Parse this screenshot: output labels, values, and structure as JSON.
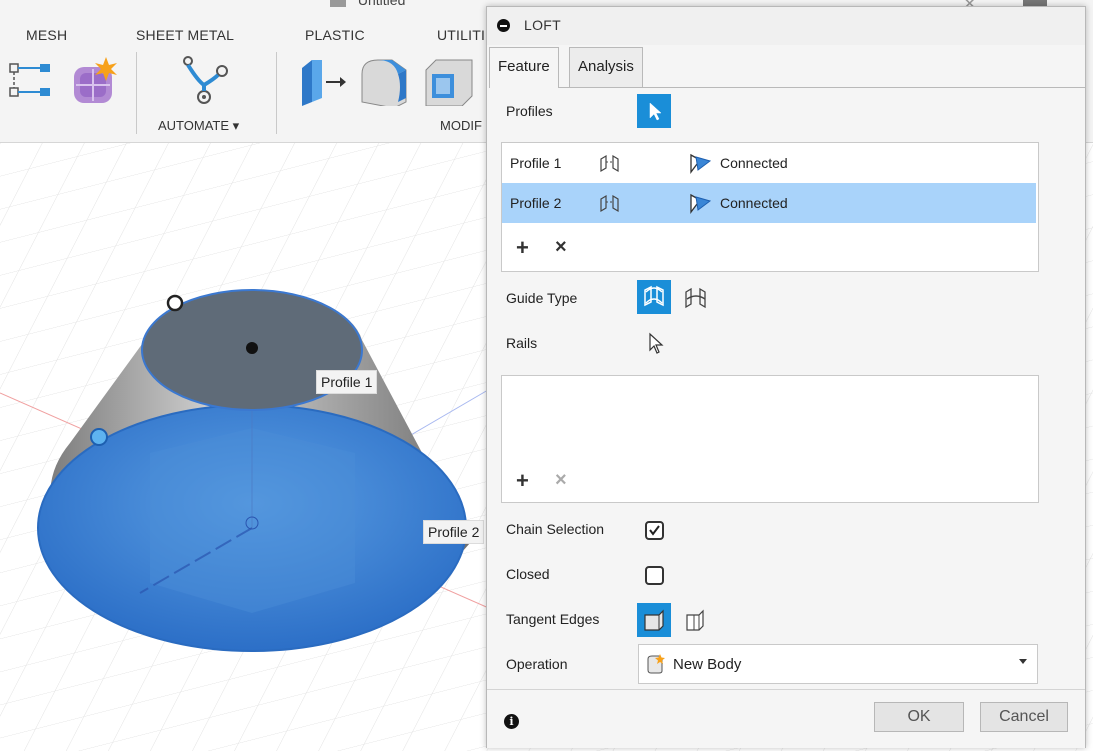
{
  "window": {
    "title": "Untitled"
  },
  "ribbon": {
    "tabs": [
      "MESH",
      "SHEET METAL",
      "PLASTIC",
      "UTILITI"
    ],
    "captions": {
      "automate": "AUTOMATE ▾",
      "modify": "MODIF"
    }
  },
  "canvas": {
    "labels": {
      "profile1": "Profile 1",
      "profile2": "Profile 2"
    }
  },
  "dialog": {
    "title": "LOFT",
    "tabs": [
      {
        "label": "Feature",
        "active": true
      },
      {
        "label": "Analysis",
        "active": false
      }
    ],
    "profiles_label": "Profiles",
    "profiles": [
      {
        "name": "Profile 1",
        "status": "Connected",
        "selected": false
      },
      {
        "name": "Profile 2",
        "status": "Connected",
        "selected": true
      }
    ],
    "guide_type_label": "Guide Type",
    "rails_label": "Rails",
    "chain_selection_label": "Chain Selection",
    "chain_selection_checked": true,
    "closed_label": "Closed",
    "closed_checked": false,
    "tangent_edges_label": "Tangent Edges",
    "operation_label": "Operation",
    "operation_value": "New Body",
    "ok_label": "OK",
    "cancel_label": "Cancel"
  },
  "colors": {
    "accent": "#1a8ed8",
    "selected_row": "#a9d3fa",
    "body_blue": "#3f86d6"
  }
}
